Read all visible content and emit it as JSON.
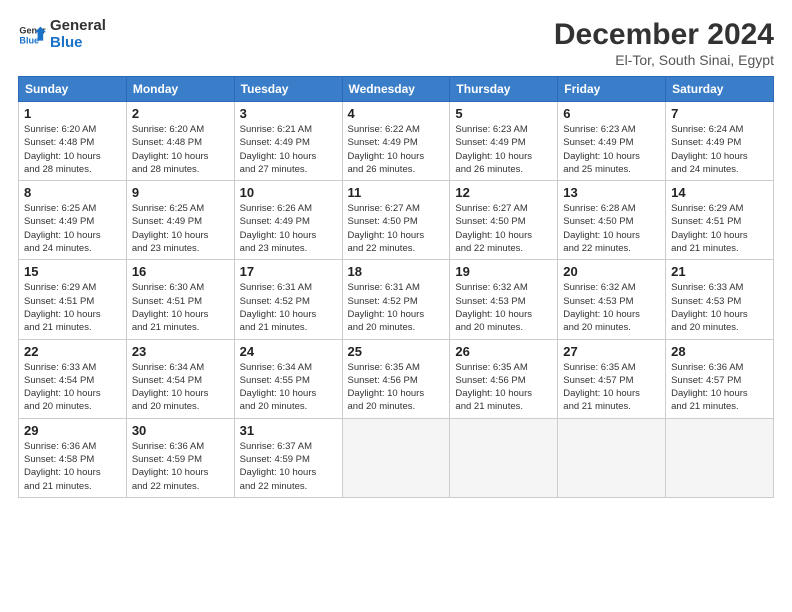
{
  "logo": {
    "line1": "General",
    "line2": "Blue"
  },
  "title": "December 2024",
  "location": "El-Tor, South Sinai, Egypt",
  "days_header": [
    "Sunday",
    "Monday",
    "Tuesday",
    "Wednesday",
    "Thursday",
    "Friday",
    "Saturday"
  ],
  "weeks": [
    [
      {
        "day": "1",
        "info": "Sunrise: 6:20 AM\nSunset: 4:48 PM\nDaylight: 10 hours\nand 28 minutes."
      },
      {
        "day": "2",
        "info": "Sunrise: 6:20 AM\nSunset: 4:48 PM\nDaylight: 10 hours\nand 28 minutes."
      },
      {
        "day": "3",
        "info": "Sunrise: 6:21 AM\nSunset: 4:49 PM\nDaylight: 10 hours\nand 27 minutes."
      },
      {
        "day": "4",
        "info": "Sunrise: 6:22 AM\nSunset: 4:49 PM\nDaylight: 10 hours\nand 26 minutes."
      },
      {
        "day": "5",
        "info": "Sunrise: 6:23 AM\nSunset: 4:49 PM\nDaylight: 10 hours\nand 26 minutes."
      },
      {
        "day": "6",
        "info": "Sunrise: 6:23 AM\nSunset: 4:49 PM\nDaylight: 10 hours\nand 25 minutes."
      },
      {
        "day": "7",
        "info": "Sunrise: 6:24 AM\nSunset: 4:49 PM\nDaylight: 10 hours\nand 24 minutes."
      }
    ],
    [
      {
        "day": "8",
        "info": "Sunrise: 6:25 AM\nSunset: 4:49 PM\nDaylight: 10 hours\nand 24 minutes."
      },
      {
        "day": "9",
        "info": "Sunrise: 6:25 AM\nSunset: 4:49 PM\nDaylight: 10 hours\nand 23 minutes."
      },
      {
        "day": "10",
        "info": "Sunrise: 6:26 AM\nSunset: 4:49 PM\nDaylight: 10 hours\nand 23 minutes."
      },
      {
        "day": "11",
        "info": "Sunrise: 6:27 AM\nSunset: 4:50 PM\nDaylight: 10 hours\nand 22 minutes."
      },
      {
        "day": "12",
        "info": "Sunrise: 6:27 AM\nSunset: 4:50 PM\nDaylight: 10 hours\nand 22 minutes."
      },
      {
        "day": "13",
        "info": "Sunrise: 6:28 AM\nSunset: 4:50 PM\nDaylight: 10 hours\nand 22 minutes."
      },
      {
        "day": "14",
        "info": "Sunrise: 6:29 AM\nSunset: 4:51 PM\nDaylight: 10 hours\nand 21 minutes."
      }
    ],
    [
      {
        "day": "15",
        "info": "Sunrise: 6:29 AM\nSunset: 4:51 PM\nDaylight: 10 hours\nand 21 minutes."
      },
      {
        "day": "16",
        "info": "Sunrise: 6:30 AM\nSunset: 4:51 PM\nDaylight: 10 hours\nand 21 minutes."
      },
      {
        "day": "17",
        "info": "Sunrise: 6:31 AM\nSunset: 4:52 PM\nDaylight: 10 hours\nand 21 minutes."
      },
      {
        "day": "18",
        "info": "Sunrise: 6:31 AM\nSunset: 4:52 PM\nDaylight: 10 hours\nand 20 minutes."
      },
      {
        "day": "19",
        "info": "Sunrise: 6:32 AM\nSunset: 4:53 PM\nDaylight: 10 hours\nand 20 minutes."
      },
      {
        "day": "20",
        "info": "Sunrise: 6:32 AM\nSunset: 4:53 PM\nDaylight: 10 hours\nand 20 minutes."
      },
      {
        "day": "21",
        "info": "Sunrise: 6:33 AM\nSunset: 4:53 PM\nDaylight: 10 hours\nand 20 minutes."
      }
    ],
    [
      {
        "day": "22",
        "info": "Sunrise: 6:33 AM\nSunset: 4:54 PM\nDaylight: 10 hours\nand 20 minutes."
      },
      {
        "day": "23",
        "info": "Sunrise: 6:34 AM\nSunset: 4:54 PM\nDaylight: 10 hours\nand 20 minutes."
      },
      {
        "day": "24",
        "info": "Sunrise: 6:34 AM\nSunset: 4:55 PM\nDaylight: 10 hours\nand 20 minutes."
      },
      {
        "day": "25",
        "info": "Sunrise: 6:35 AM\nSunset: 4:56 PM\nDaylight: 10 hours\nand 20 minutes."
      },
      {
        "day": "26",
        "info": "Sunrise: 6:35 AM\nSunset: 4:56 PM\nDaylight: 10 hours\nand 21 minutes."
      },
      {
        "day": "27",
        "info": "Sunrise: 6:35 AM\nSunset: 4:57 PM\nDaylight: 10 hours\nand 21 minutes."
      },
      {
        "day": "28",
        "info": "Sunrise: 6:36 AM\nSunset: 4:57 PM\nDaylight: 10 hours\nand 21 minutes."
      }
    ],
    [
      {
        "day": "29",
        "info": "Sunrise: 6:36 AM\nSunset: 4:58 PM\nDaylight: 10 hours\nand 21 minutes."
      },
      {
        "day": "30",
        "info": "Sunrise: 6:36 AM\nSunset: 4:59 PM\nDaylight: 10 hours\nand 22 minutes."
      },
      {
        "day": "31",
        "info": "Sunrise: 6:37 AM\nSunset: 4:59 PM\nDaylight: 10 hours\nand 22 minutes."
      },
      {
        "day": "",
        "info": ""
      },
      {
        "day": "",
        "info": ""
      },
      {
        "day": "",
        "info": ""
      },
      {
        "day": "",
        "info": ""
      }
    ]
  ]
}
